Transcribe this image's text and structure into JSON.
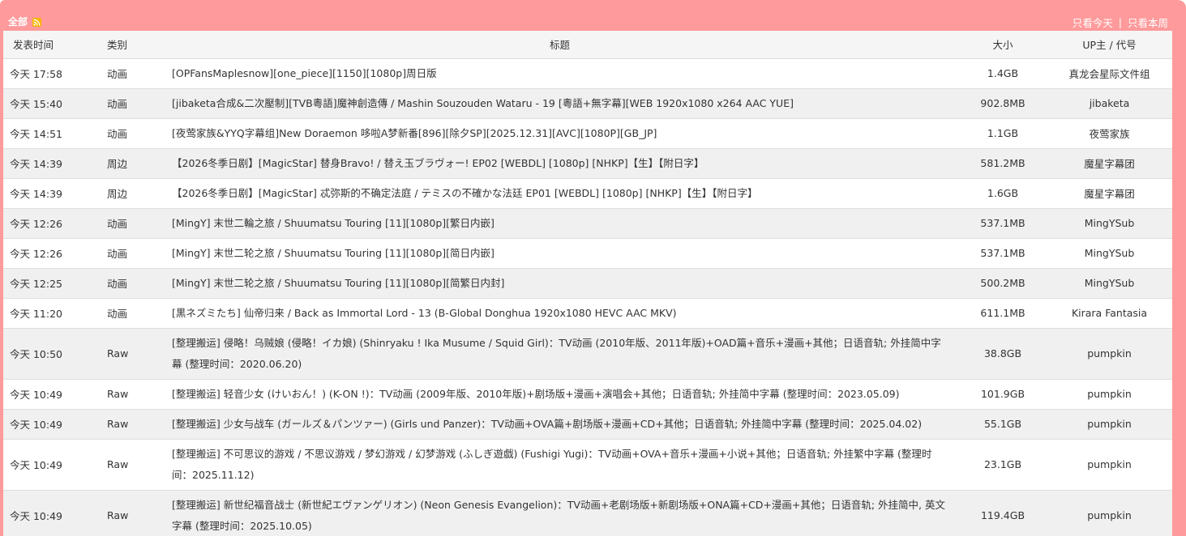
{
  "header": {
    "all_label": "全部",
    "rss_icon": "rss-icon",
    "today_only": "只看今天",
    "separator": "|",
    "this_week_only": "只看本周"
  },
  "colors": {
    "frame": "#fe9a9b",
    "header_row": "#f5f5f5",
    "row_alt": "#f0f0f0",
    "rss": "#f7b500"
  },
  "table": {
    "columns": [
      "发表时间",
      "类别",
      "标题",
      "大小",
      "UP主 / 代号"
    ],
    "rows": [
      {
        "time": "今天 17:58",
        "category": "动画",
        "title": "[OPFansMaplesnow][one_piece][1150][1080p]周日版",
        "size": "1.4GB",
        "uploader": "真龙会星际文件组"
      },
      {
        "time": "今天 15:40",
        "category": "动画",
        "title": "[jibaketa合成&二次壓制][TVB粵語]魔神創造傳 / Mashin Souzouden Wataru - 19 [粵語+無字幕][WEB 1920x1080 x264 AAC YUE]",
        "size": "902.8MB",
        "uploader": "jibaketa"
      },
      {
        "time": "今天 14:51",
        "category": "动画",
        "title": "[夜莺家族&YYQ字幕组]New Doraemon 哆啦A梦新番[896][除夕SP][2025.12.31][AVC][1080P][GB_JP]",
        "size": "1.1GB",
        "uploader": "夜莺家族"
      },
      {
        "time": "今天 14:39",
        "category": "周边",
        "title": "【2026冬季日剧】[MagicStar] 替身Bravo! / 替え玉ブラヴォー! EP02 [WEBDL] [1080p] [NHKP]【生】【附日字】",
        "size": "581.2MB",
        "uploader": "魔星字幕团"
      },
      {
        "time": "今天 14:39",
        "category": "周边",
        "title": "【2026冬季日剧】[MagicStar] 忒弥斯的不确定法庭 / テミスの不確かな法廷 EP01 [WEBDL] [1080p] [NHKP]【生】【附日字】",
        "size": "1.6GB",
        "uploader": "魔星字幕团"
      },
      {
        "time": "今天 12:26",
        "category": "动画",
        "title": "[MingY] 末世二輪之旅 / Shuumatsu Touring [11][1080p][繁日内嵌]",
        "size": "537.1MB",
        "uploader": "MingYSub"
      },
      {
        "time": "今天 12:26",
        "category": "动画",
        "title": "[MingY] 末世二轮之旅 / Shuumatsu Touring [11][1080p][简日内嵌]",
        "size": "537.1MB",
        "uploader": "MingYSub"
      },
      {
        "time": "今天 12:25",
        "category": "动画",
        "title": "[MingY] 末世二轮之旅 / Shuumatsu Touring [11][1080p][简繁日内封]",
        "size": "500.2MB",
        "uploader": "MingYSub"
      },
      {
        "time": "今天 11:20",
        "category": "动画",
        "title": "[黒ネズミたち] 仙帝归来 / Back as Immortal Lord - 13 (B-Global Donghua 1920x1080 HEVC AAC MKV)",
        "size": "611.1MB",
        "uploader": "Kirara Fantasia"
      },
      {
        "time": "今天 10:50",
        "category": "Raw",
        "title": "[整理搬运] 侵略！乌贼娘 (侵略！イカ娘) (Shinryaku ! Ika Musume / Squid Girl)：TV动画 (2010年版、2011年版)+OAD篇+音乐+漫画+其他；日语音轨; 外挂简中字幕 (整理时间：2020.06.20)",
        "size": "38.8GB",
        "uploader": "pumpkin"
      },
      {
        "time": "今天 10:49",
        "category": "Raw",
        "title": "[整理搬运] 轻音少女 (けいおん！) (K-ON !)：TV动画 (2009年版、2010年版)+剧场版+漫画+演唱会+其他；日语音轨; 外挂简中字幕 (整理时间：2023.05.09)",
        "size": "101.9GB",
        "uploader": "pumpkin"
      },
      {
        "time": "今天 10:49",
        "category": "Raw",
        "title": "[整理搬运] 少女与战车 (ガールズ＆パンツァー) (Girls und Panzer)：TV动画+OVA篇+剧场版+漫画+CD+其他；日语音轨; 外挂简中字幕 (整理时间：2025.04.02)",
        "size": "55.1GB",
        "uploader": "pumpkin"
      },
      {
        "time": "今天 10:49",
        "category": "Raw",
        "title": "[整理搬运] 不可思议的游戏 / 不思议游戏 / 梦幻游戏 / 幻梦游戏 (ふしぎ遊戯) (Fushigi Yugi)：TV动画+OVA+音乐+漫画+小说+其他；日语音轨; 外挂繁中字幕 (整理时间：2025.11.12)",
        "size": "23.1GB",
        "uploader": "pumpkin"
      },
      {
        "time": "今天 10:49",
        "category": "Raw",
        "title": "[整理搬运] 新世纪福音战士 (新世紀エヴァンゲリオン) (Neon Genesis Evangelion)：TV动画+老剧场版+新剧场版+ONA篇+CD+漫画+其他；日语音轨; 外挂简中, 英文字幕 (整理时间：2025.10.05)",
        "size": "119.4GB",
        "uploader": "pumpkin"
      }
    ]
  }
}
